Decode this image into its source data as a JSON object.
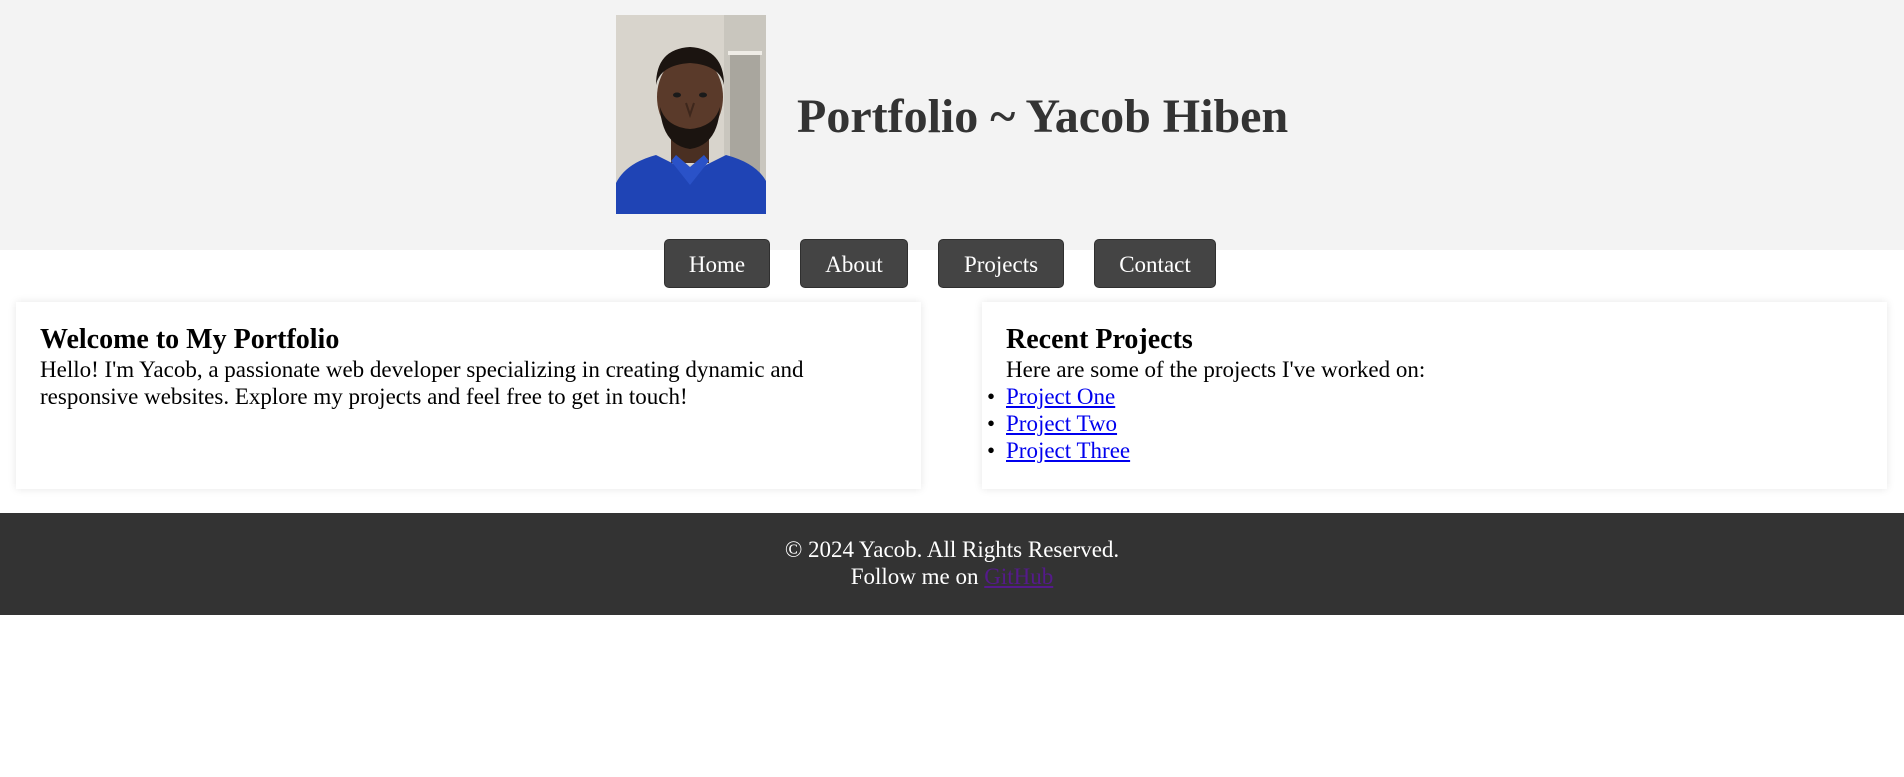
{
  "header": {
    "title": "Portfolio ~ Yacob Hiben",
    "avatar": "profile-photo"
  },
  "nav": {
    "items": [
      {
        "label": "Home"
      },
      {
        "label": "About"
      },
      {
        "label": "Projects"
      },
      {
        "label": "Contact"
      }
    ]
  },
  "welcome": {
    "heading": "Welcome to My Portfolio",
    "text": "Hello! I'm Yacob, a passionate web developer specializing in creating dynamic and responsive websites. Explore my projects and feel free to get in touch!"
  },
  "projects": {
    "heading": "Recent Projects",
    "intro": "Here are some of the projects I've worked on:",
    "items": [
      {
        "label": "Project One"
      },
      {
        "label": "Project Two"
      },
      {
        "label": "Project Three"
      }
    ]
  },
  "footer": {
    "copyright": "© 2024 Yacob. All Rights Reserved.",
    "follow_prefix": "Follow me on ",
    "follow_link": "GitHub"
  },
  "colors": {
    "header_bg": "#f3f3f3",
    "nav_button_bg": "#444444",
    "footer_bg": "#333333",
    "link": "#0000ee",
    "visited_link": "#551a8b"
  }
}
